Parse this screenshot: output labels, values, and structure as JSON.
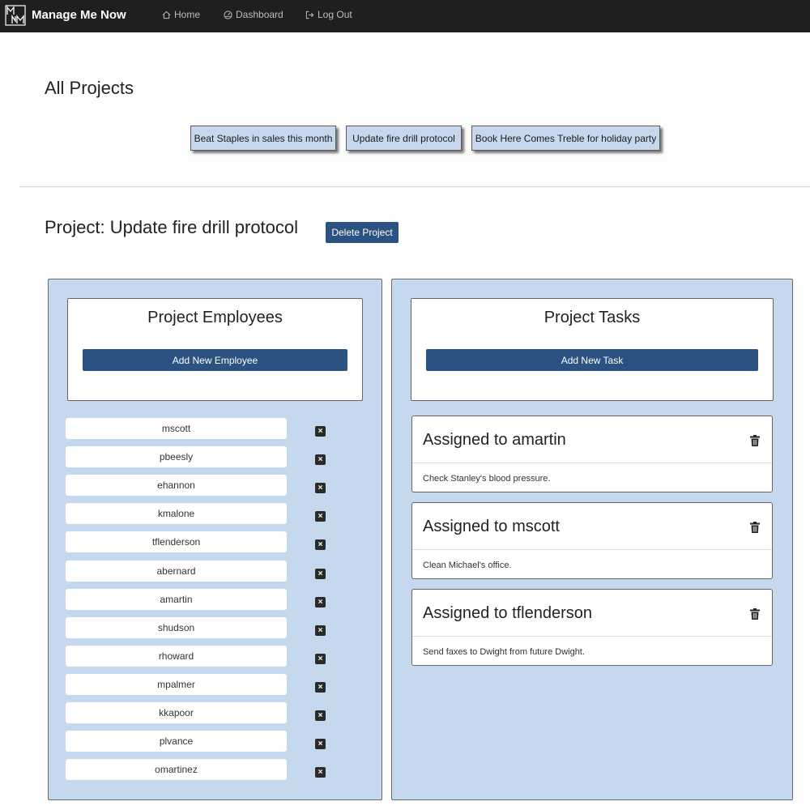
{
  "navbar": {
    "brand": "Manage Me Now",
    "logo_icon": "mnm-logo-icon",
    "links": [
      {
        "label": "Home",
        "icon": "home-icon"
      },
      {
        "label": "Dashboard",
        "icon": "dashboard-icon"
      },
      {
        "label": "Log Out",
        "icon": "logout-icon"
      }
    ]
  },
  "all_projects": {
    "heading": "All Projects",
    "projects": [
      "Beat Staples in sales this month",
      "Update fire drill protocol",
      "Book Here Comes Treble for holiday party"
    ]
  },
  "project": {
    "heading": "Project: Update fire drill protocol",
    "delete_label": "Delete Project"
  },
  "employees_panel": {
    "title": "Project Employees",
    "add_label": "Add New Employee",
    "remove_icon": "close-icon",
    "employees": [
      "mscott",
      "pbeesly",
      "ehannon",
      "kmalone",
      "tflenderson",
      "abernard",
      "amartin",
      "shudson",
      "rhoward",
      "mpalmer",
      "kkapoor",
      "plvance",
      "omartinez"
    ]
  },
  "tasks_panel": {
    "title": "Project Tasks",
    "add_label": "Add New Task",
    "delete_icon": "trash-icon",
    "tasks": [
      {
        "assignee": "Assigned to amartin",
        "description": "Check Stanley's blood pressure."
      },
      {
        "assignee": "Assigned to mscott",
        "description": "Clean Michael's office."
      },
      {
        "assignee": "Assigned to tflenderson",
        "description": "Send faxes to Dwight from future Dwight."
      }
    ]
  },
  "colors": {
    "navbar": "#1f1f1f",
    "accent": "#2c5282",
    "panel": "#c6d8ee",
    "project_button": "#c7d8ee"
  }
}
